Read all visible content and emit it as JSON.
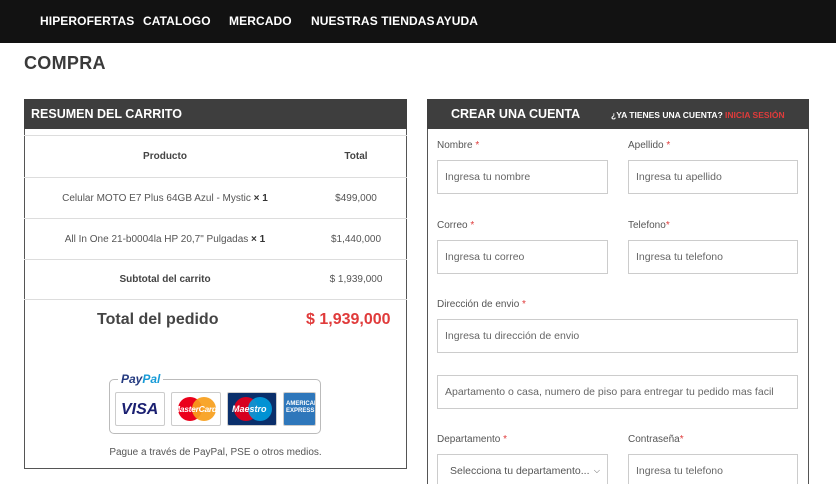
{
  "nav": {
    "items": [
      {
        "label": "HIPEROFERTAS"
      },
      {
        "label": "CATALOGO"
      },
      {
        "label": "MERCADO"
      },
      {
        "label": "NUESTRAS TIENDAS"
      },
      {
        "label": "AYUDA"
      }
    ]
  },
  "page": {
    "title": "COMPRA"
  },
  "cart": {
    "header": "RESUMEN DEL CARRITO",
    "columns": {
      "product": "Producto",
      "total": "Total"
    },
    "items": [
      {
        "name": "Celular MOTO E7 Plus 64GB Azul - Mystic",
        "qty": "× 1",
        "total": "$499,000"
      },
      {
        "name": "All In One 21-b0004la HP 20,7\" Pulgadas",
        "qty": "× 1",
        "total": "$1,440,000"
      }
    ],
    "subtotal_label": "Subtotal del carrito",
    "subtotal_value": "$ 1,939,000",
    "total_label": "Total del pedido",
    "total_value": "$ 1,939,000",
    "paypal": {
      "pay": "Pay",
      "pal": "Pal"
    },
    "cards": {
      "visa": "VISA",
      "mastercard": "MasterCard",
      "maestro": "Maestro",
      "amex": "AMERICAN EXPRESS"
    },
    "pay_text": "Pague a través de PayPal, PSE o otros medios."
  },
  "account": {
    "header": "CREAR UNA CUENTA",
    "question": "¿YA TIENES UNA CUENTA?",
    "login_link": "INICIA SESIÓN",
    "required_mark": "*",
    "fields": {
      "nombre": {
        "label": "Nombre",
        "placeholder": "Ingresa tu nombre"
      },
      "apellido": {
        "label": "Apellido",
        "placeholder": "Ingresa tu apellido"
      },
      "correo": {
        "label": "Correo",
        "placeholder": "Ingresa tu correo"
      },
      "telefono": {
        "label": "Telefono",
        "placeholder": "Ingresa tu telefono"
      },
      "direccion": {
        "label": "Dirección de envio",
        "placeholder": "Ingresa tu dirección de envio"
      },
      "apartamento": {
        "placeholder": "Apartamento o casa, numero de piso para entregar tu pedido mas facil"
      },
      "departamento": {
        "label": "Departamento",
        "selected": "Selecciona tu departamento..."
      },
      "contrasena": {
        "label": "Contraseña",
        "placeholder": "Ingresa tu telefono"
      }
    }
  },
  "colors": {
    "accent": "#e03b3b",
    "nav_bg": "#121212",
    "panel_header": "#3e3e3e"
  }
}
